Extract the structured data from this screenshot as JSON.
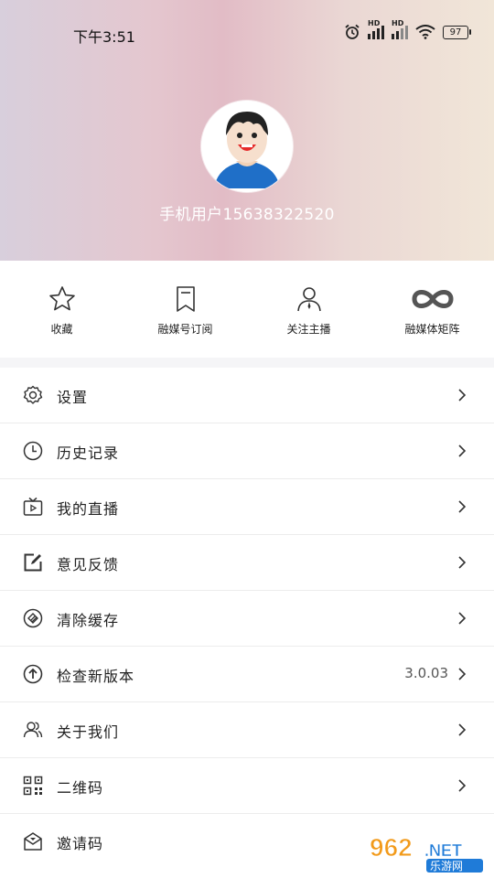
{
  "status_bar": {
    "time": "下午3:51",
    "signal1_label": "HD",
    "signal2_label": "HD",
    "battery": "97"
  },
  "profile": {
    "username": "手机用户15638322520"
  },
  "quick_actions": [
    {
      "label": "收藏",
      "icon": "star-icon"
    },
    {
      "label": "融媒号订阅",
      "icon": "bookmark-icon"
    },
    {
      "label": "关注主播",
      "icon": "person-icon"
    },
    {
      "label": "融媒体矩阵",
      "icon": "infinity-icon"
    }
  ],
  "menu": [
    {
      "label": "设置",
      "icon": "gear-icon",
      "value": ""
    },
    {
      "label": "历史记录",
      "icon": "clock-icon",
      "value": ""
    },
    {
      "label": "我的直播",
      "icon": "tv-icon",
      "value": ""
    },
    {
      "label": "意见反馈",
      "icon": "edit-icon",
      "value": ""
    },
    {
      "label": "清除缓存",
      "icon": "clear-cache-icon",
      "value": ""
    },
    {
      "label": "检查新版本",
      "icon": "upload-icon",
      "value": "3.0.03"
    },
    {
      "label": "关于我们",
      "icon": "people-icon",
      "value": ""
    },
    {
      "label": "二维码",
      "icon": "qrcode-icon",
      "value": ""
    },
    {
      "label": "邀请码",
      "icon": "envelope-icon",
      "value": ""
    }
  ],
  "watermark": {
    "text_top": "962",
    "text_right": ".NET",
    "text_bottom": "乐游网"
  }
}
